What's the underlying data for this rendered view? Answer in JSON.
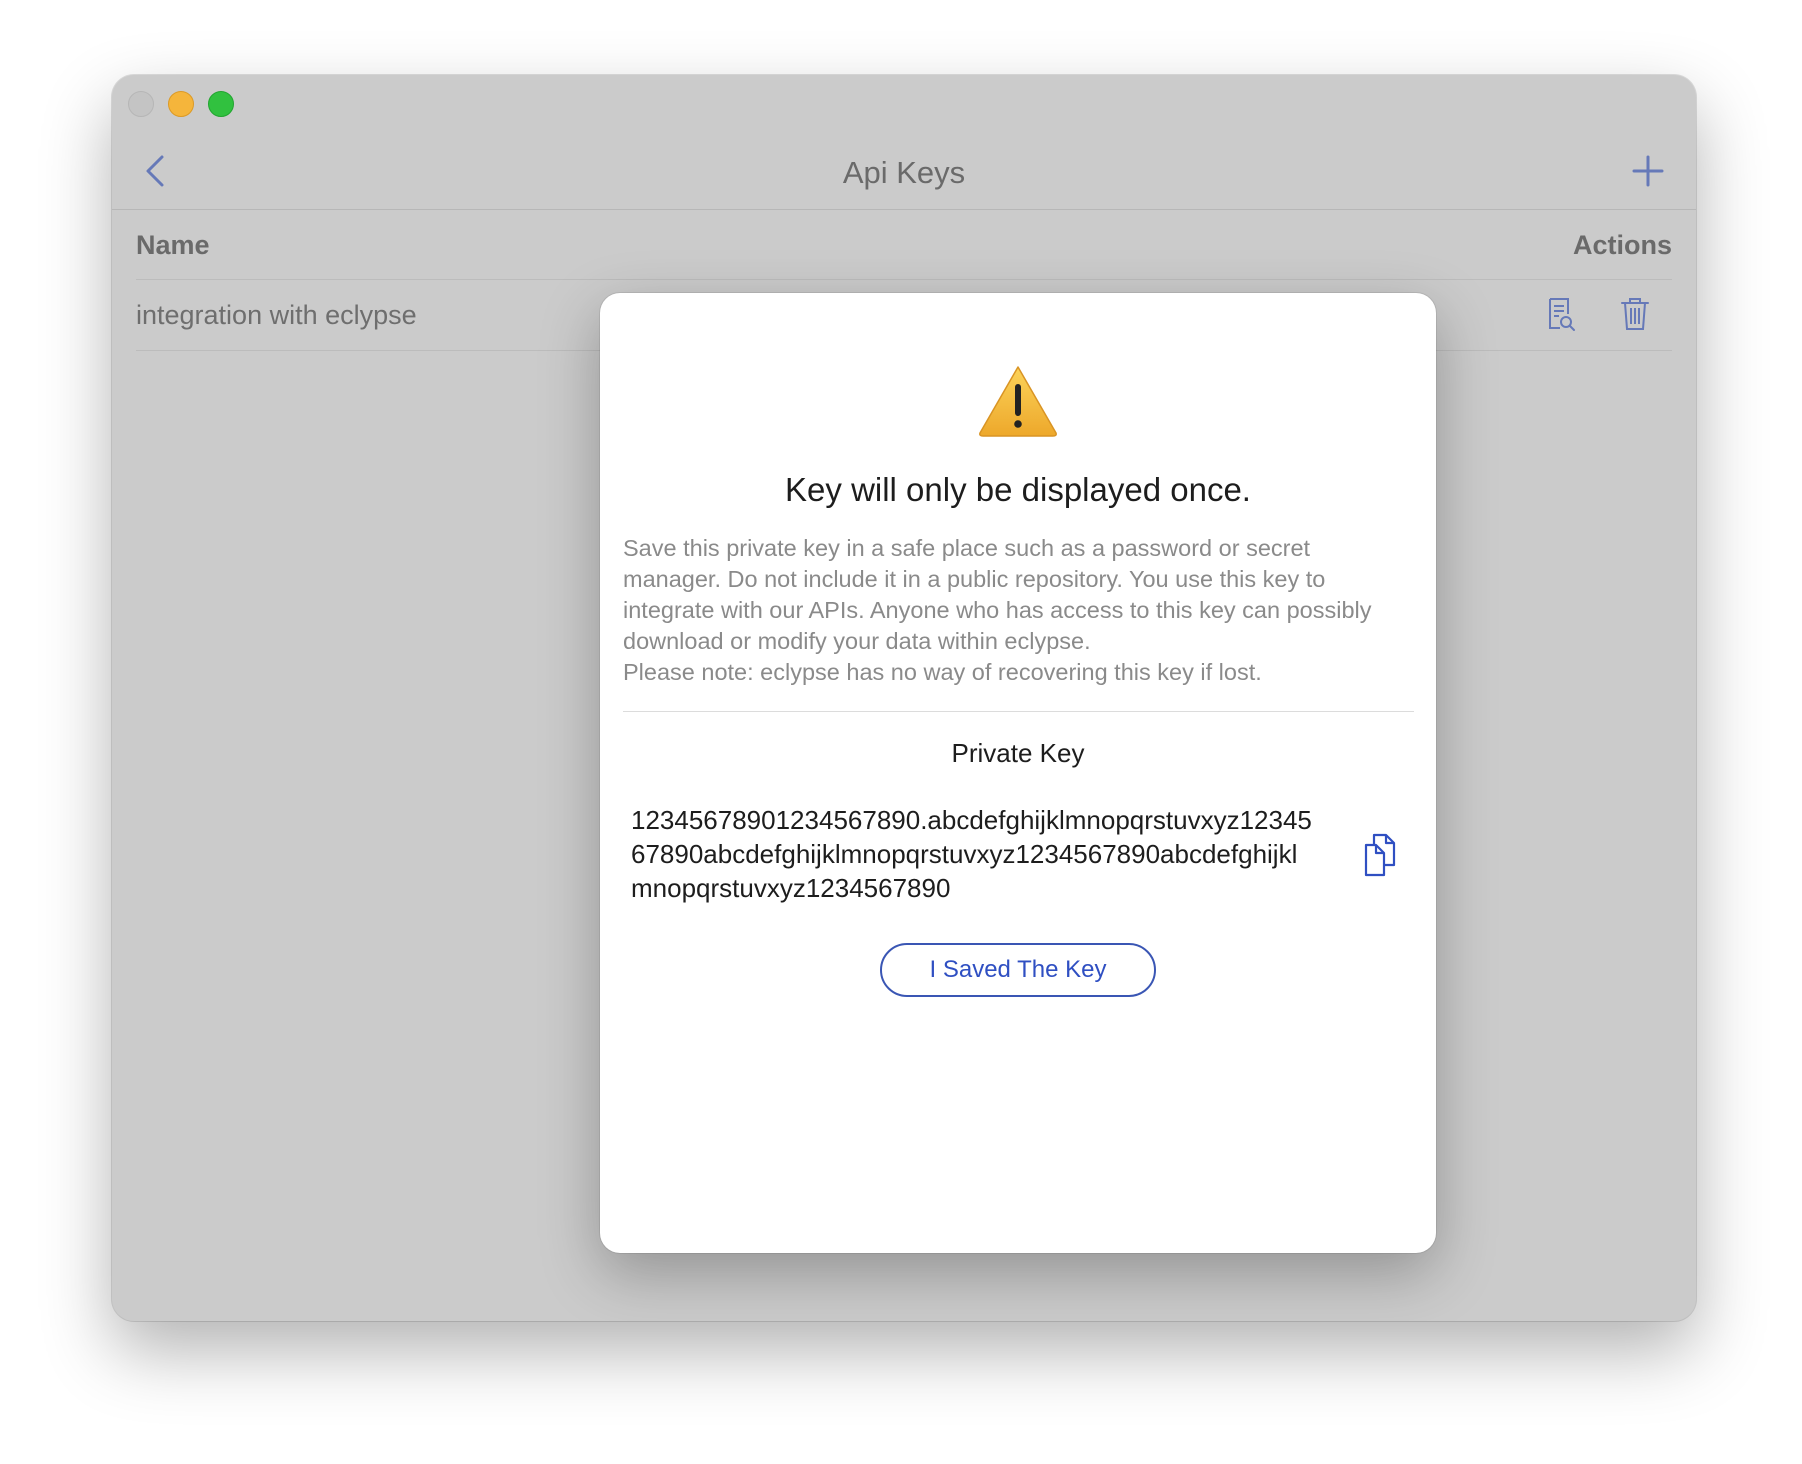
{
  "window": {
    "title": "Api Keys"
  },
  "table": {
    "columns": {
      "name": "Name",
      "actions": "Actions"
    },
    "rows": [
      {
        "name": "integration with eclypse",
        "actions": [
          "view-document-icon",
          "trash-icon"
        ]
      }
    ]
  },
  "modal": {
    "icon": "warning-icon",
    "title": "Key will only be displayed once.",
    "description_lines": [
      "Save this private key in a safe place such as a password or secret",
      "manager. Do not include it in a public repository. You use this key to",
      "integrate with our APIs. Anyone who has access to this key can possibly",
      "download or modify your data within eclypse.",
      "Please note: eclypse has no way of recovering this key if lost."
    ],
    "private_key_label": "Private Key",
    "private_key_lines": [
      "12345678901234567890.abcdefghijklmnopqrstuvxyz12345",
      "67890abcdefghijklmnopqrstuvxyz1234567890abcdefghijkl",
      "mnopqrstuvxyz1234567890"
    ],
    "copy_icon": "copy-icon",
    "confirm_button": "I Saved The Key"
  },
  "colors": {
    "accent": "#2f4fc2",
    "overlay_bg": "#cbcbcb",
    "warning": "#f2b431"
  }
}
